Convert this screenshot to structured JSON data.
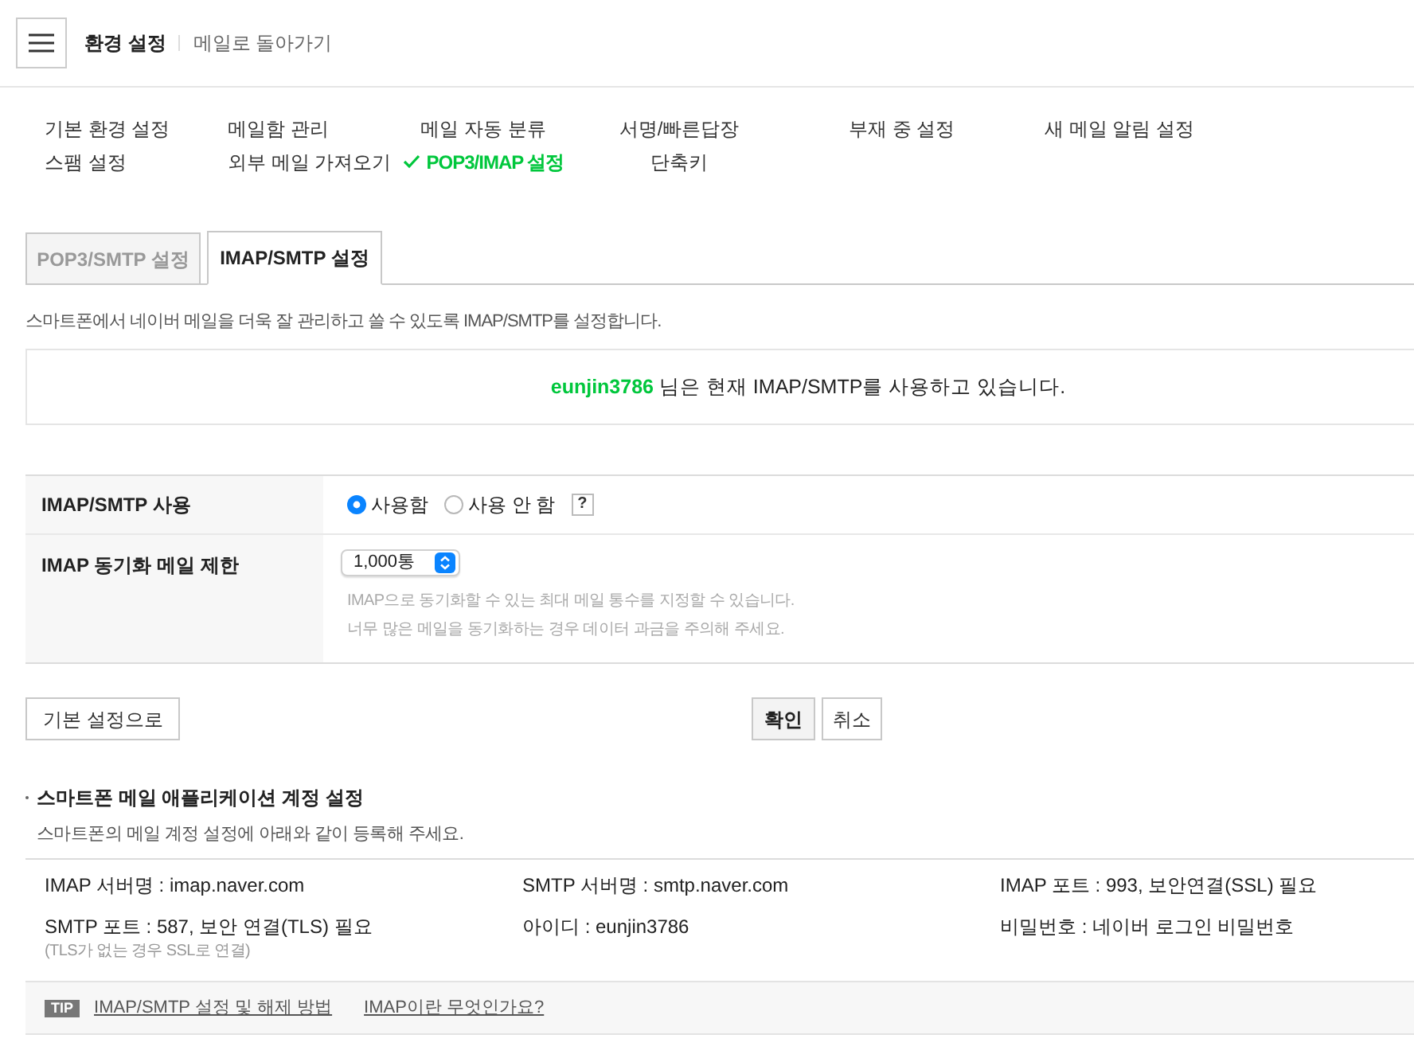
{
  "header": {
    "title": "환경 설정",
    "back_link": "메일로 돌아가기"
  },
  "nav_menu": [
    {
      "label": "기본 환경 설정",
      "selected": false
    },
    {
      "label": "메일함 관리",
      "selected": false
    },
    {
      "label": "메일 자동 분류",
      "selected": false
    },
    {
      "label": "서명/빠른답장",
      "selected": false
    },
    {
      "label": "부재 중 설정",
      "selected": false
    },
    {
      "label": "새 메일 알림 설정",
      "selected": false
    },
    {
      "label": "스팸 설정",
      "selected": false
    },
    {
      "label": "외부 메일 가져오기",
      "selected": false
    },
    {
      "label": "POP3/IMAP 설정",
      "selected": true
    },
    {
      "label": "단축키",
      "selected": false
    }
  ],
  "tabs": [
    {
      "label": "POP3/SMTP 설정",
      "selected": false
    },
    {
      "label": "IMAP/SMTP 설정",
      "selected": true
    }
  ],
  "description": "스마트폰에서 네이버 메일을 더욱 잘 관리하고 쓸 수 있도록 IMAP/SMTP를 설정합니다.",
  "status": {
    "user_id": "eunjin3786",
    "message": "님은 현재 IMAP/SMTP를 사용하고 있습니다."
  },
  "settings": [
    {
      "kind": "radio",
      "label": "IMAP/SMTP 사용",
      "options": [
        {
          "label": "사용함",
          "selected": true
        },
        {
          "label": "사용 안 함",
          "selected": false
        }
      ],
      "help": "?"
    },
    {
      "kind": "select",
      "label": "IMAP 동기화 메일 제한",
      "value": "1,000통",
      "notes": [
        "IMAP으로 동기화할 수 있는 최대 메일 통수를 지정할 수 있습니다.",
        "너무 많은 메일을 동기화하는 경우 데이터 과금을 주의해 주세요."
      ]
    }
  ],
  "buttons": {
    "reset": "기본 설정으로",
    "confirm": "확인",
    "cancel": "취소"
  },
  "account_section": {
    "title": "스마트폰 메일 애플리케이션 계정 설정",
    "subtitle": "스마트폰의 메일 계정 설정에 아래와 같이 등록해 주세요.",
    "items": [
      {
        "text": "IMAP 서버명 : imap.naver.com"
      },
      {
        "text": "SMTP 서버명 : smtp.naver.com"
      },
      {
        "text": "IMAP 포트 : 993, 보안연결(SSL) 필요"
      },
      {
        "text": "SMTP 포트 : 587, 보안 연결(TLS) 필요",
        "note": "(TLS가 없는 경우 SSL로 연결)"
      },
      {
        "text": "아이디 : eunjin3786"
      },
      {
        "text": "비밀번호 : 네이버 로그인 비밀번호"
      }
    ]
  },
  "tip": {
    "badge": "TIP",
    "links": [
      "IMAP/SMTP 설정 및 해제 방법",
      "IMAP이란 무엇인가요?"
    ]
  }
}
